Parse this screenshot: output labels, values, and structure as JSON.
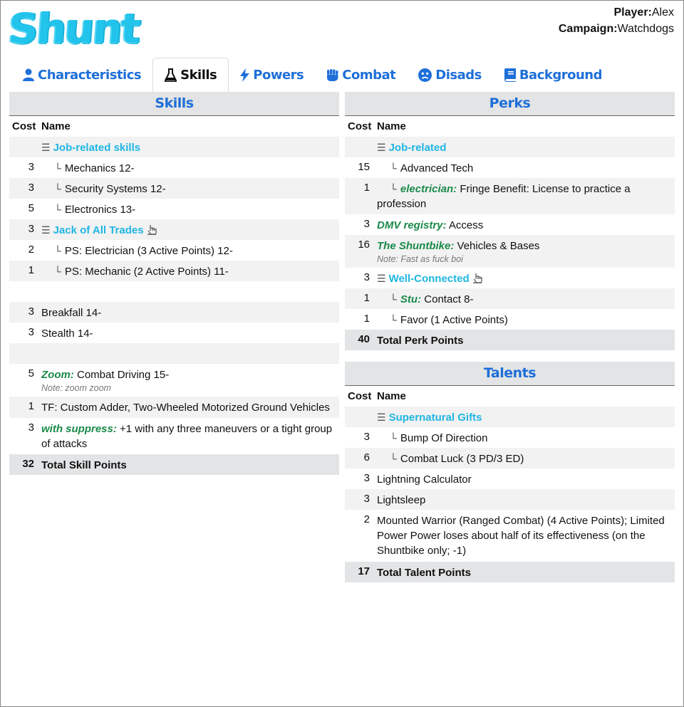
{
  "logo": "Shunt",
  "meta": {
    "player_label": "Player:",
    "player": "Alex",
    "campaign_label": "Campaign:",
    "campaign": "Watchdogs"
  },
  "tabs": [
    {
      "label": "Characteristics",
      "icon": "user-icon"
    },
    {
      "label": "Skills",
      "icon": "flask-icon",
      "active": true
    },
    {
      "label": "Powers",
      "icon": "bolt-icon"
    },
    {
      "label": "Combat",
      "icon": "fist-icon"
    },
    {
      "label": "Disads",
      "icon": "frown-icon"
    },
    {
      "label": "Background",
      "icon": "book-icon"
    }
  ],
  "headers": {
    "cost": "Cost",
    "name": "Name"
  },
  "skills": {
    "title": "Skills",
    "group1": "Job-related skills",
    "r1": {
      "cost": "3",
      "name": "Mechanics 12-"
    },
    "r2": {
      "cost": "3",
      "name": "Security Systems 12-"
    },
    "r3": {
      "cost": "5",
      "name": "Electronics 13-"
    },
    "r4": {
      "cost": "3",
      "name": "Jack of All Trades"
    },
    "r5": {
      "cost": "2",
      "name": "PS: Electrician (3 Active Points) 12-"
    },
    "r6": {
      "cost": "1",
      "name": "PS: Mechanic (2 Active Points) 11-"
    },
    "r7": {
      "cost": "3",
      "name": "Breakfall 14-"
    },
    "r8": {
      "cost": "3",
      "name": "Stealth 14-"
    },
    "r9": {
      "cost": "5",
      "em": "Zoom:",
      "name": "Combat Driving 15-",
      "note": "Note: zoom zoom"
    },
    "r10": {
      "cost": "1",
      "name": "TF: Custom Adder, Two-Wheeled Motorized Ground Vehicles"
    },
    "r11": {
      "cost": "3",
      "em": "with suppress:",
      "name": "+1 with any three maneuvers or a tight group of attacks"
    },
    "total": {
      "cost": "32",
      "name": "Total Skill Points"
    }
  },
  "perks": {
    "title": "Perks",
    "group1": "Job-related",
    "r1": {
      "cost": "15",
      "name": "Advanced Tech"
    },
    "r2": {
      "cost": "1",
      "em": "electrician:",
      "name": "Fringe Benefit: License to practice a profession"
    },
    "r3": {
      "cost": "3",
      "em": "DMV registry:",
      "name": "Access"
    },
    "r4": {
      "cost": "16",
      "em": "The Shuntbike:",
      "name": "Vehicles & Bases",
      "note": "Note: Fast as fuck boi"
    },
    "r5": {
      "cost": "3",
      "name": "Well-Connected"
    },
    "r6": {
      "cost": "1",
      "em": "Stu:",
      "name": "Contact 8-"
    },
    "r7": {
      "cost": "1",
      "name": "Favor (1 Active Points)"
    },
    "total": {
      "cost": "40",
      "name": "Total Perk Points"
    }
  },
  "talents": {
    "title": "Talents",
    "group1": "Supernatural Gifts",
    "r1": {
      "cost": "3",
      "name": "Bump Of Direction"
    },
    "r2": {
      "cost": "6",
      "name": "Combat Luck (3 PD/3 ED)"
    },
    "r3": {
      "cost": "3",
      "name": "Lightning Calculator"
    },
    "r4": {
      "cost": "3",
      "name": "Lightsleep"
    },
    "r5": {
      "cost": "2",
      "name": "Mounted Warrior (Ranged Combat) (4 Active Points); Limited Power Power loses about half of its effectiveness (on the Shuntbike only; -1)"
    },
    "total": {
      "cost": "17",
      "name": "Total Talent Points"
    }
  }
}
